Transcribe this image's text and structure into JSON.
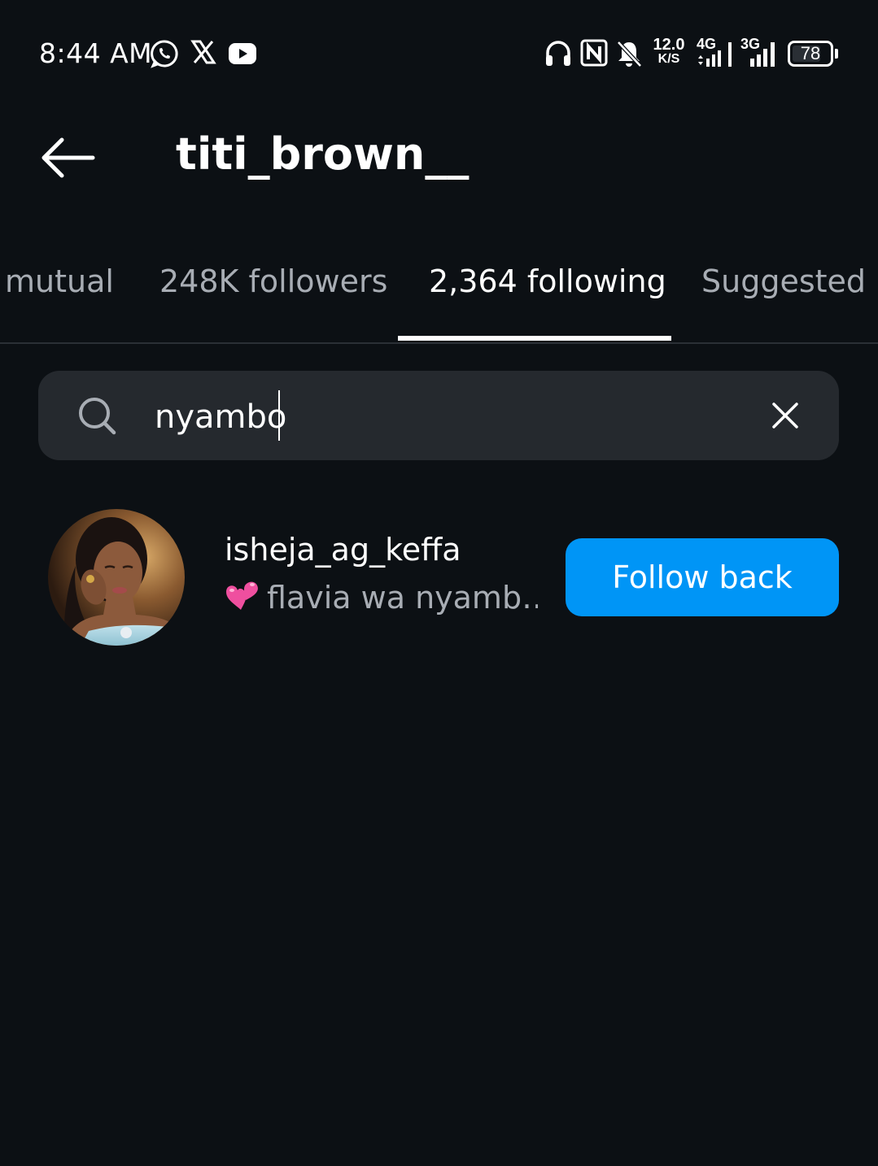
{
  "status_bar": {
    "time": "8:44 AM",
    "notification_icons": [
      "whatsapp-icon",
      "x-icon",
      "youtube-icon"
    ],
    "system_icons": [
      "headphones-icon",
      "nfc-icon",
      "bell-off-icon"
    ],
    "net_speed_value": "12.0",
    "net_speed_unit": "K/S",
    "signal_1_label": "4G",
    "signal_2_label": "3G",
    "battery_level": "78"
  },
  "header": {
    "title": "titi_brown__"
  },
  "tabs": [
    {
      "label": "mutual",
      "active": false
    },
    {
      "label": "248K followers",
      "active": false
    },
    {
      "label": "2,364 following",
      "active": true
    },
    {
      "label": "Suggested",
      "active": false
    }
  ],
  "search": {
    "value": "nyambo",
    "placeholder": "Search"
  },
  "results": [
    {
      "username": "isheja_ag_keffa",
      "subtitle": "flavia wa nyamb…",
      "subtitle_emoji": "two-hearts-icon",
      "button_label": "Follow back"
    }
  ],
  "colors": {
    "background": "#0c1014",
    "accent": "#0095f6",
    "search_bg": "#25292e",
    "muted_text": "#a8adb4"
  }
}
